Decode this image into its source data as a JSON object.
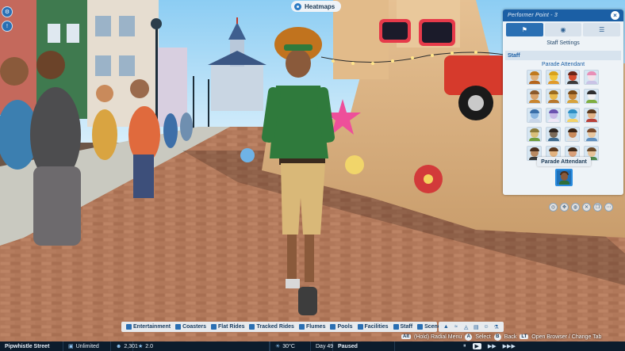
{
  "scene": {
    "description_colors": {
      "sky": "#9fd3f4",
      "path": "#a86a4c",
      "shirt": "#2f7a3c",
      "shorts": "#d9b878"
    }
  },
  "top": {
    "heatmaps_label": "Heatmaps",
    "heatmaps_icon": "heatmap-icon"
  },
  "left_toolbar": [
    {
      "icon": "settings-icon",
      "glyph": "⚙"
    },
    {
      "icon": "alert-icon",
      "glyph": "!"
    }
  ],
  "panel": {
    "title": "Performer Point - 3",
    "close_glyph": "×",
    "tabs": [
      {
        "icon": "staff-settings-icon",
        "glyph": "⚑",
        "active": true
      },
      {
        "icon": "info-icon",
        "glyph": "◉",
        "active": false
      },
      {
        "icon": "list-icon",
        "glyph": "☰",
        "active": false
      }
    ],
    "subtitle": "Staff Settings",
    "section": "Staff",
    "role": "Parade Attendant",
    "portraits": [
      {
        "bg": "#d6e6f2",
        "face": "#e0b17a",
        "hair": "#c07a1e",
        "body": "#b5651d"
      },
      {
        "bg": "#d6e6f2",
        "face": "#f1c53b",
        "hair": "#d9a21b",
        "body": "#e09a2c"
      },
      {
        "bg": "#d6e6f2",
        "face": "#d34b2f",
        "hair": "#6b2518",
        "body": "#3b3b3b"
      },
      {
        "bg": "#d6e6f2",
        "face": "#f4e1ea",
        "hair": "#e88fb7",
        "body": "#c9c3e6"
      },
      {
        "bg": "#d6e6f2",
        "face": "#d9a36b",
        "hair": "#8c5a2b",
        "body": "#c9852e"
      },
      {
        "bg": "#d6e6f2",
        "face": "#e8b84a",
        "hair": "#9b6b1e",
        "body": "#b7772c"
      },
      {
        "bg": "#d6e6f2",
        "face": "#c8893e",
        "hair": "#7a4b18",
        "body": "#d7a23b"
      },
      {
        "bg": "#d6e6f2",
        "face": "#f2f2f2",
        "hair": "#2e2e2e",
        "body": "#7fae3f"
      },
      {
        "bg": "#d6e6f2",
        "face": "#8bb6e0",
        "hair": "#3a6fa8",
        "body": "#c8d5e8"
      },
      {
        "bg": "#d6e6f2",
        "face": "#c7b8e6",
        "hair": "#6a53b0",
        "body": "#efe7f6"
      },
      {
        "bg": "#d6e6f2",
        "face": "#7cc4e8",
        "hair": "#2d8fc4",
        "body": "#f1d36b"
      },
      {
        "bg": "#d6e6f2",
        "face": "#e3b58a",
        "hair": "#5c3a1e",
        "body": "#b9413a"
      },
      {
        "bg": "#d6e6f2",
        "face": "#d9c07a",
        "hair": "#8a7a3a",
        "body": "#6f9f3e"
      },
      {
        "bg": "#d6e6f2",
        "face": "#7b6a58",
        "hair": "#2d2520",
        "body": "#3f6b8f"
      },
      {
        "bg": "#d6e6f2",
        "face": "#c98a5b",
        "hair": "#3b2516",
        "body": "#e2e2e2"
      },
      {
        "bg": "#d6e6f2",
        "face": "#e8c7a0",
        "hair": "#7a4a2a",
        "body": "#5f8fbf"
      },
      {
        "bg": "#d6e6f2",
        "face": "#b98a62",
        "hair": "#4a2e1c",
        "body": "#3a3a3a"
      },
      {
        "bg": "#d6e6f2",
        "face": "#e2b27f",
        "hair": "#5b381c",
        "body": "#4c7fb5"
      },
      {
        "bg": "#d6e6f2",
        "face": "#d9a07a",
        "hair": "#3e2a1a",
        "body": "#8f4a4a"
      },
      {
        "bg": "#d6e6f2",
        "face": "#e6c39a",
        "hair": "#6b4a2a",
        "body": "#4f8a4f"
      }
    ],
    "tooltip": "Parade Attendant",
    "selected_portrait": "parade-attendant-portrait"
  },
  "mini_tools": [
    {
      "icon": "camera-icon",
      "glyph": "◎"
    },
    {
      "icon": "move-icon",
      "glyph": "✥"
    },
    {
      "icon": "paint-icon",
      "glyph": "◍"
    },
    {
      "icon": "delete-icon",
      "glyph": "✕"
    },
    {
      "icon": "copy-icon",
      "glyph": "❐"
    },
    {
      "icon": "more-icon",
      "glyph": "⋯"
    }
  ],
  "categories": [
    {
      "label": "Entertainment",
      "icon": "entertainment-icon"
    },
    {
      "label": "Coasters",
      "icon": "coasters-icon"
    },
    {
      "label": "Flat Rides",
      "icon": "flat-rides-icon"
    },
    {
      "label": "Tracked Rides",
      "icon": "tracked-rides-icon"
    },
    {
      "label": "Flumes",
      "icon": "flumes-icon"
    },
    {
      "label": "Pools",
      "icon": "pools-icon"
    },
    {
      "label": "Facilities",
      "icon": "facilities-icon"
    },
    {
      "label": "Staff",
      "icon": "staff-icon"
    },
    {
      "label": "Scenery",
      "icon": "scenery-icon"
    }
  ],
  "right_tools": [
    {
      "icon": "terrain-icon",
      "glyph": "▲"
    },
    {
      "icon": "water-icon",
      "glyph": "≈"
    },
    {
      "icon": "path-icon",
      "glyph": "◬"
    },
    {
      "icon": "finance-icon",
      "glyph": "▤"
    },
    {
      "icon": "guest-icon",
      "glyph": "☺"
    },
    {
      "icon": "research-icon",
      "glyph": "⚗"
    }
  ],
  "hints": {
    "alt_key": "Alt",
    "radial": "(Hold) Radial Menu",
    "select": "Select",
    "back": "Back",
    "open_browser": "Open Browser / Change Tab",
    "select_key": "A",
    "back_key": "B",
    "browser_key": "LT"
  },
  "status": {
    "park_name": "Pipwhistle Street",
    "money": "Unlimited",
    "guests": "2,301",
    "rating": "2.0",
    "temperature": "30°C",
    "day": "Day 49",
    "state": "Paused",
    "speed_icons": [
      "⏸",
      "▶",
      "▶▶",
      "▶▶▶"
    ]
  }
}
